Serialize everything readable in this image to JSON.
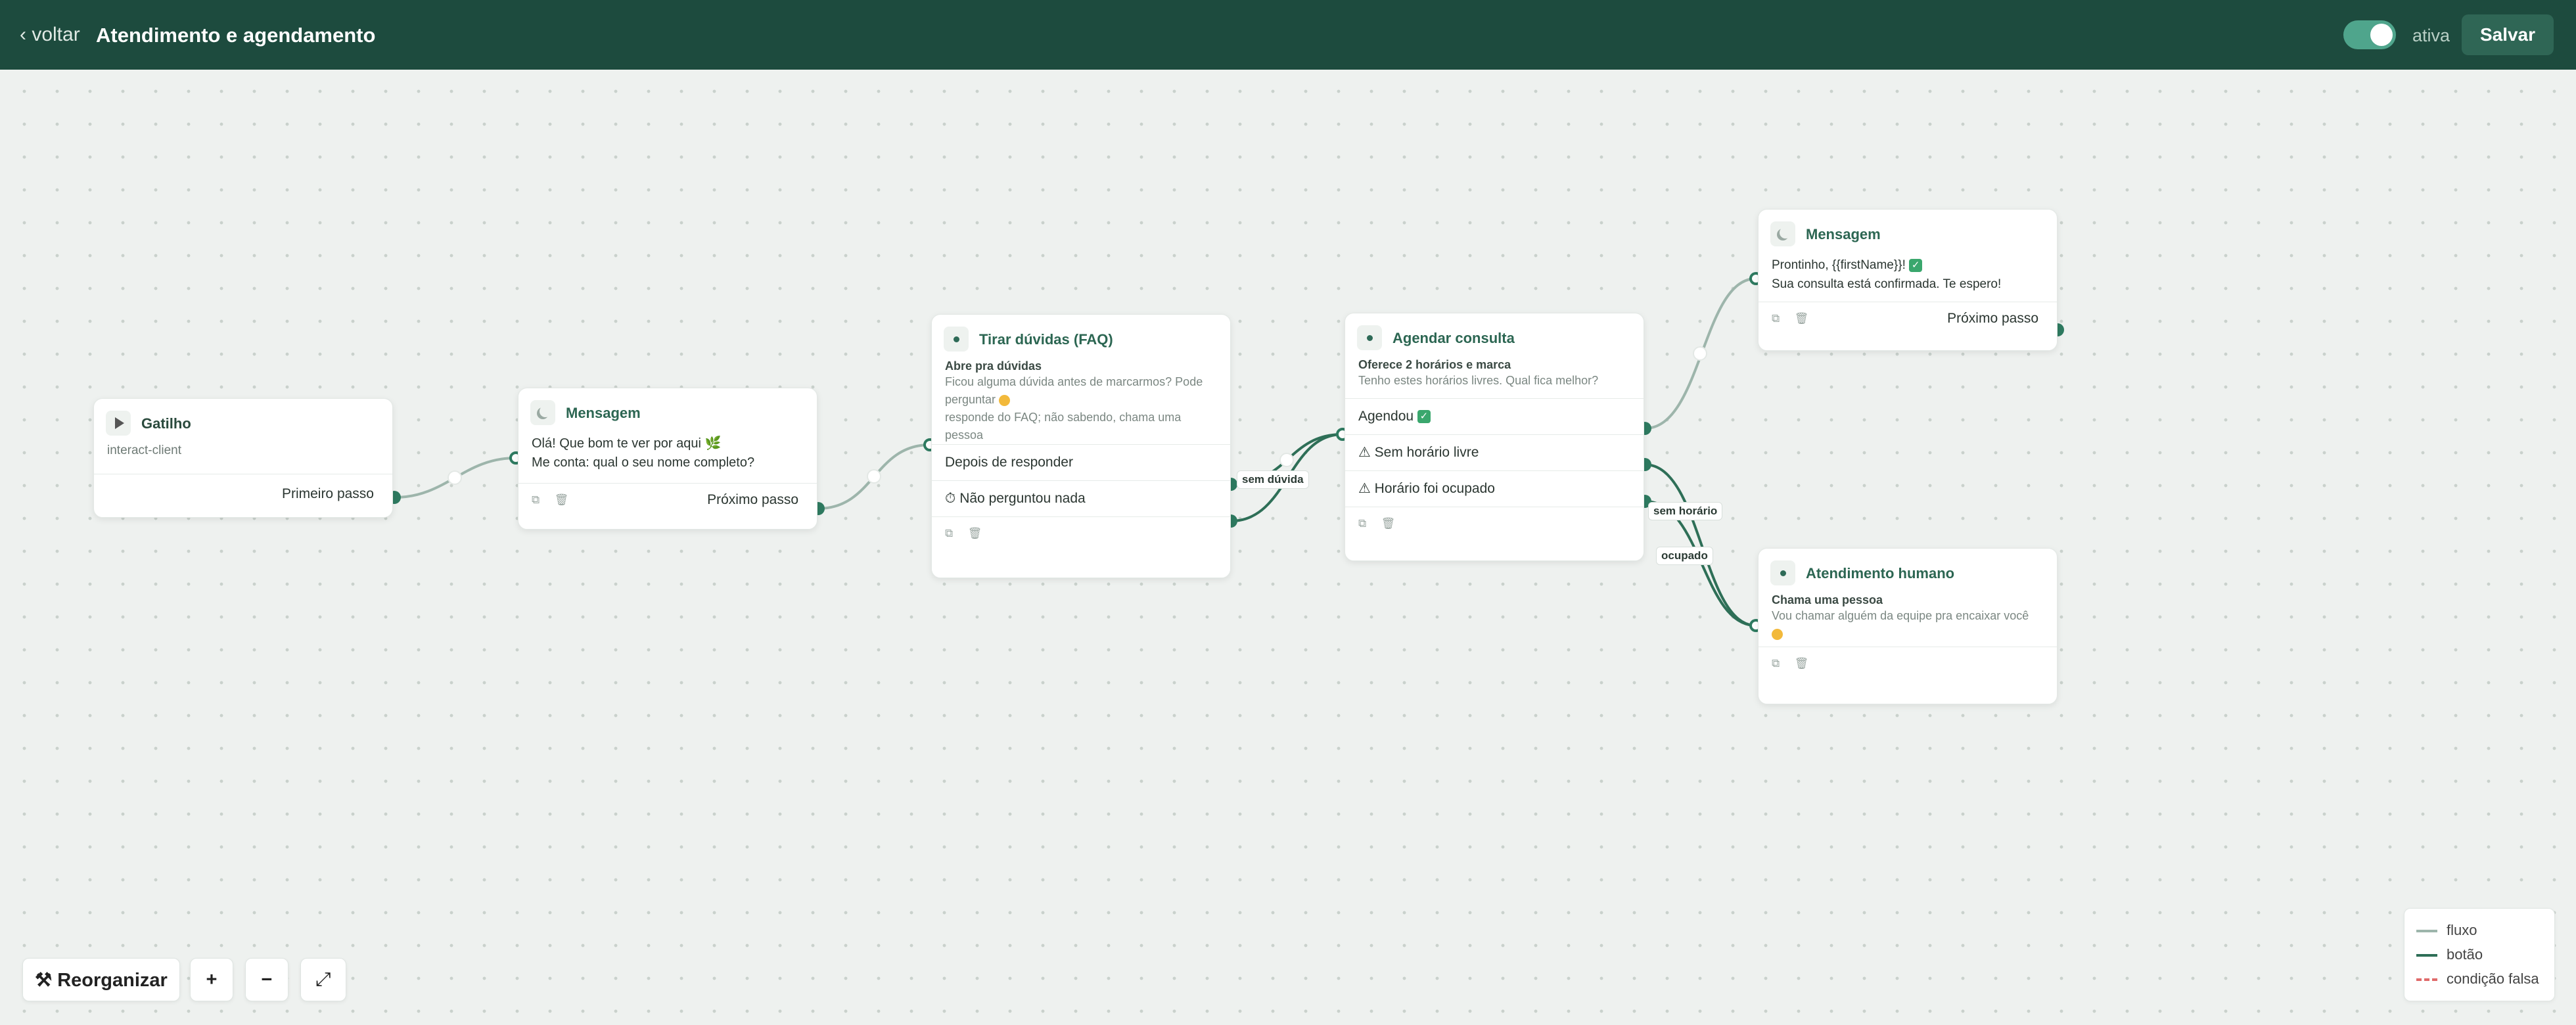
{
  "header": {
    "back_label": "‹ voltar",
    "title": "Atendimento e agendamento",
    "toggle_label": "ativa",
    "save_label": "Salvar"
  },
  "colors": {
    "header_bg": "#1d4b3e",
    "accent": "#2e7a60",
    "flow_edge": "#9db5ab",
    "button_edge": "#2e6f57",
    "false_condition_edge": "#e06b6b"
  },
  "nodes": {
    "trigger": {
      "icon": "play-icon",
      "title": "Gatilho",
      "subtitle": "interact-client",
      "next_label": "Primeiro passo"
    },
    "message1": {
      "icon": "chat-icon",
      "title": "Mensagem",
      "line1": "Olá! Que bom te ver por aqui 🌿",
      "line2": "Me conta: qual o seu nome completo?",
      "next_label": "Próximo passo"
    },
    "faq": {
      "icon": "bullet-icon",
      "title": "Tirar dúvidas (FAQ)",
      "label": "Abre pra dúvidas",
      "desc1": "Ficou alguma dúvida antes de marcarmos? Pode perguntar",
      "desc2": "responde do FAQ; não sabendo, chama uma pessoa",
      "row1": "Depois de responder",
      "row2": "⏱ Não perguntou nada"
    },
    "schedule": {
      "icon": "bullet-icon",
      "title": "Agendar consulta",
      "label": "Oferece 2 horários e marca",
      "desc": "Tenho estes horários livres. Qual fica melhor?",
      "row1": "Agendou",
      "row2": "⚠ Sem horário livre",
      "row3": "⚠ Horário foi ocupado"
    },
    "message2": {
      "icon": "chat-icon",
      "title": "Mensagem",
      "line1": "Prontinho, {{firstName}}!",
      "line2": "Sua consulta está confirmada. Te espero!",
      "next_label": "Próximo passo"
    },
    "human": {
      "icon": "bullet-icon",
      "title": "Atendimento humano",
      "label": "Chama uma pessoa",
      "desc": "Vou chamar alguém da equipe pra encaixar você"
    }
  },
  "edge_labels": {
    "sem_duvida": "sem dúvida",
    "sem_horario": "sem horário",
    "ocupado": "ocupado"
  },
  "controls": {
    "reorganize_label": "⚒ Reorganizar",
    "zoom_in_label": "+",
    "zoom_out_label": "−",
    "fit_label": "⤢"
  },
  "legend": {
    "flow": "fluxo",
    "button": "botão",
    "false_condition": "condição falsa"
  }
}
